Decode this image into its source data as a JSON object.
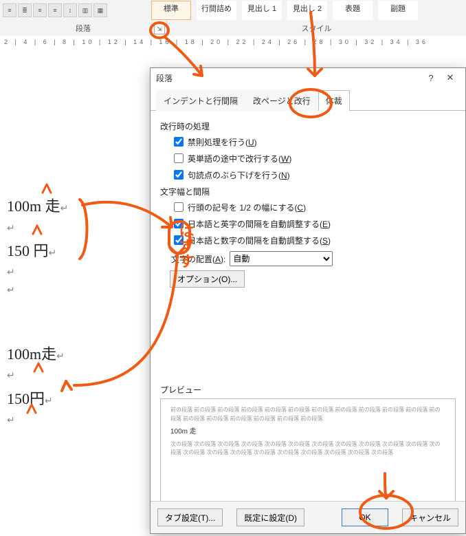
{
  "ribbon": {
    "paragraph_group": "段落",
    "style_group": "スタイル",
    "styles": [
      "標準",
      "行間詰め",
      "見出し 1",
      "見出し 2",
      "表題",
      "副題"
    ],
    "launcher_glyph": "⇲"
  },
  "ruler": {
    "ticks": "2  |  4  |  6  |  8  |  10 | 12 | 14 | 16 | 18 | 20 | 22 | 24 | 26 | 28 | 30 | 32 | 34 | 36"
  },
  "document": {
    "lines_before": [
      "100m 走",
      "150 円",
      ""
    ],
    "lines_after": [
      "100m走",
      "150円",
      ""
    ]
  },
  "dialog": {
    "title": "段落",
    "help": "?",
    "close": "✕",
    "tabs": [
      "インデントと行間隔",
      "改ページと改行",
      "体裁"
    ],
    "active_tab": 2,
    "section_linebreak": "改行時の処理",
    "cb_kinsoku": {
      "label": "禁則処理を行う(",
      "key": "U",
      "tail": ")",
      "checked": true
    },
    "cb_eword": {
      "label": "英単語の途中で改行する(",
      "key": "W",
      "tail": ")",
      "checked": false
    },
    "cb_punct": {
      "label": "句読点のぶら下げを行う(",
      "key": "N",
      "tail": ")",
      "checked": true
    },
    "section_spacing": "文字幅と間隔",
    "cb_half": {
      "label": "行頭の記号を 1/2 の幅にする(",
      "key": "C",
      "tail": ")",
      "checked": false
    },
    "cb_jpnen": {
      "label": "日本語と英字の間隔を自動調整する(",
      "key": "E",
      "tail": ")",
      "checked": true
    },
    "cb_jpnnum": {
      "label": "日本語と数字の間隔を自動調整する(",
      "key": "S",
      "tail": ")",
      "checked": true
    },
    "align_label_pre": "文字の配置(",
    "align_key": "A",
    "align_label_post": "):",
    "align_value": "自動",
    "options_btn": "オプション(O)...",
    "preview_label": "プレビュー",
    "preview_fill_before": "前の段落 前の段落 前の段落 前の段落 前の段落 前の段落 前の段落 前の段落 前の段落 前の段落 前の段落 前の段落 前の段落 前の段落 前の段落 前の段落 前の段落 前の段落",
    "preview_sample": "100m 走",
    "preview_fill_after": "次の段落 次の段落 次の段落 次の段落 次の段落 次の段落 次の段落 次の段落 次の段落 次の段落 次の段落 次の段落 次の段落 次の段落 次の段落 次の段落 次の段落 次の段落 次の段落 次の段落 次の段落",
    "footer": {
      "tab_settings": "タブ設定(T)...",
      "set_default": "既定に設定(D)",
      "ok": "OK",
      "cancel": "キャンセル"
    }
  },
  "annotation": {
    "remove": "はずす"
  }
}
